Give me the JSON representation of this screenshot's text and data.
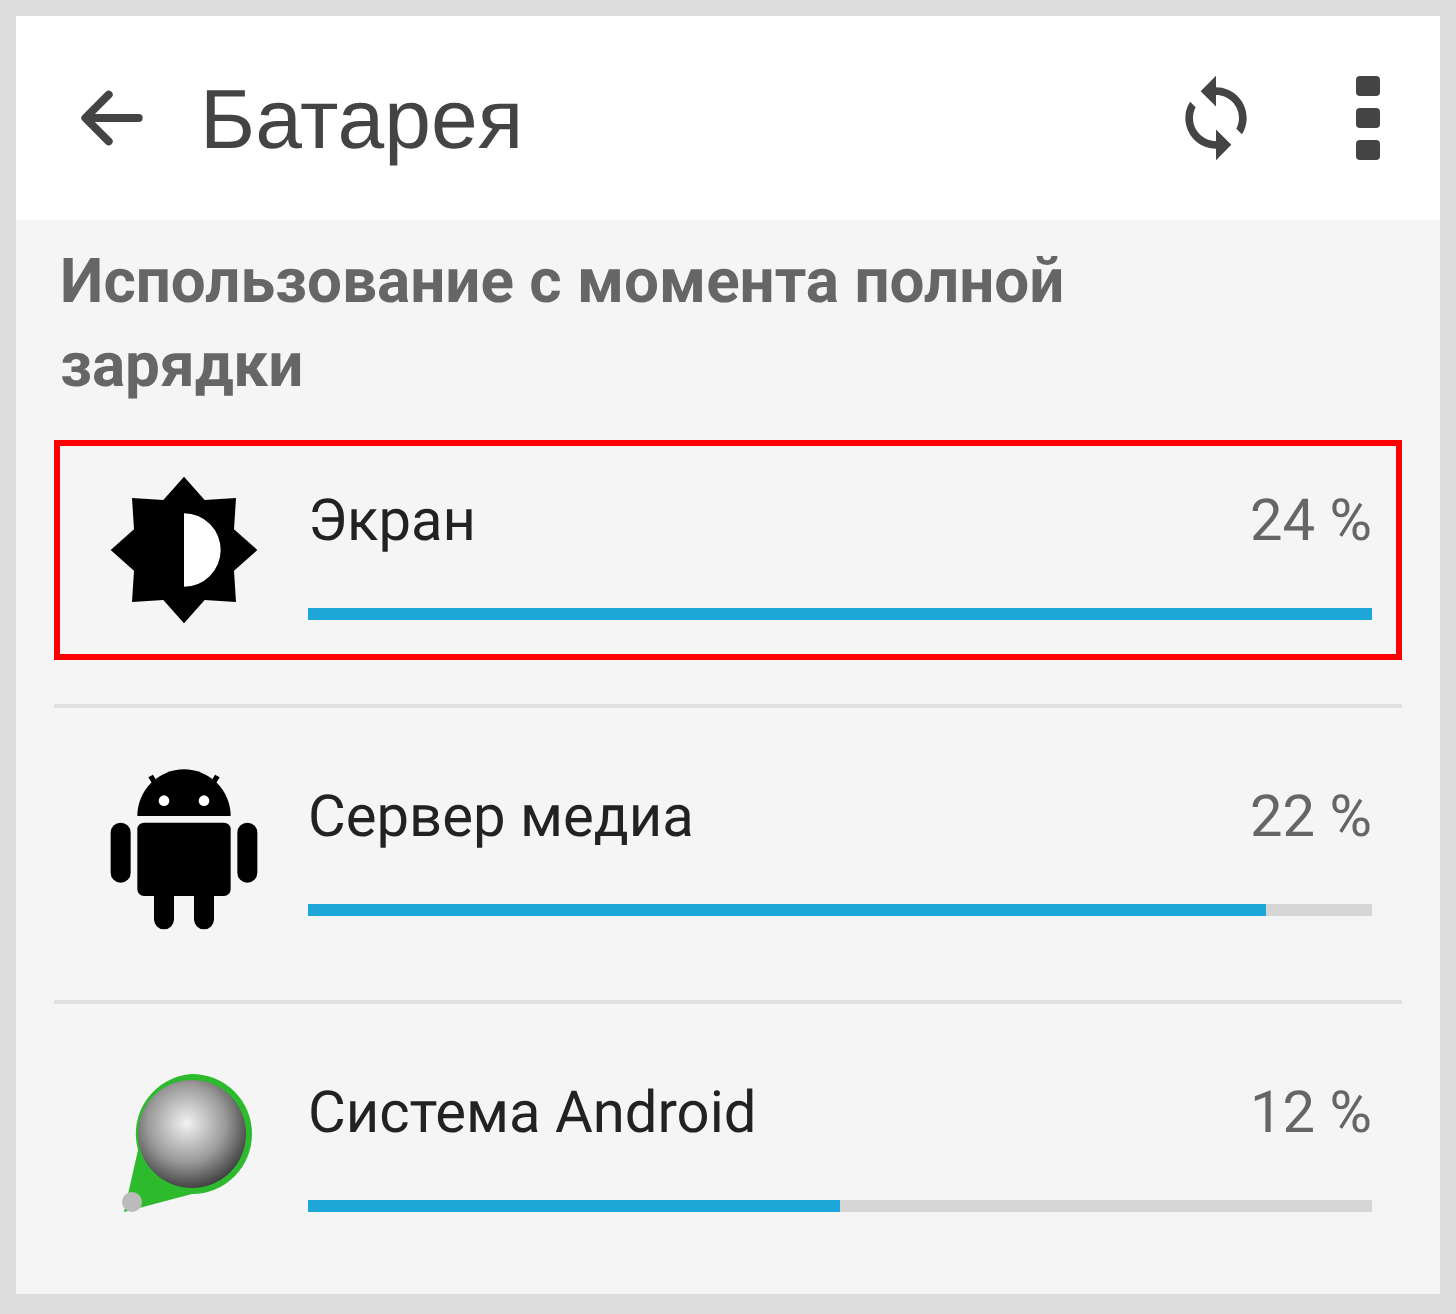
{
  "app_bar": {
    "title": "Батарея"
  },
  "section": {
    "title": "Использование с момента полной зарядки"
  },
  "items": [
    {
      "kind": "brightness",
      "name": "Экран",
      "percent": "24 %",
      "level": 1.0,
      "highlighted": true
    },
    {
      "kind": "android",
      "name": "Сервер медиа",
      "percent": "22 %",
      "level": 0.9,
      "highlighted": false
    },
    {
      "kind": "system",
      "name": "Система Android",
      "percent": "12 %",
      "level": 0.5,
      "highlighted": false
    }
  ]
}
